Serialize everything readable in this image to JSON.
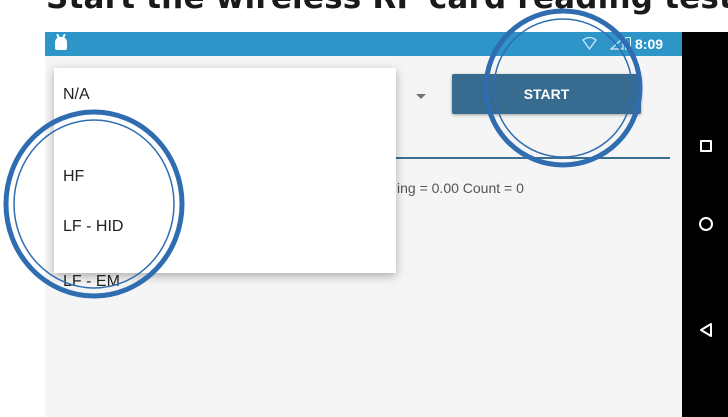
{
  "caption": "Start the wireless RF card reading test.",
  "status_bar": {
    "time": "8:09",
    "app_icon": "android-robot-icon",
    "wifi_icon": "wifi-icon",
    "signal_icon": "signal-icon",
    "battery_icon": "battery-icon"
  },
  "spinner": {
    "selected": "N/A",
    "options": [
      "N/A",
      "HF",
      "LF - HID",
      "LF - EM"
    ],
    "arrow_icon": "dropdown-arrow-icon"
  },
  "start_button": {
    "label": "START"
  },
  "reading_status": "ing = 0.00 Count = 0",
  "nav_bar": {
    "recents_icon": "square-recents-icon",
    "home_icon": "circle-home-icon",
    "back_icon": "triangle-back-icon"
  },
  "colors": {
    "status_bar": "#2e95c9",
    "button": "#376b90",
    "annotation": "#2f6db0"
  }
}
